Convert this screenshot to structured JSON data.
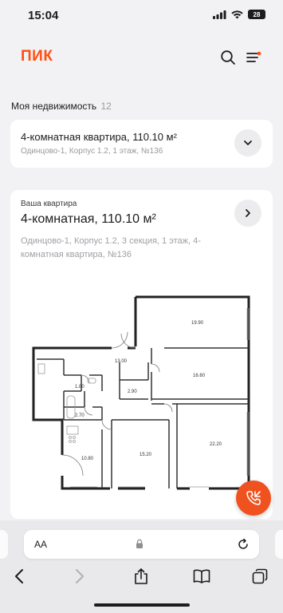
{
  "status": {
    "time": "15:04",
    "battery": "28"
  },
  "header": {
    "logo": "ПИК"
  },
  "section": {
    "title": "Моя недвижимость",
    "count": "12"
  },
  "collapsed_card": {
    "title": "4-комнатная квартира, 110.10 м²",
    "subtitle": "Одинцово-1, Корпус 1.2, 1 этаж, №136"
  },
  "main_card": {
    "label": "Ваша квартира",
    "title": "4-комнатная, 110.10 м²",
    "description": "Одинцово-1, Корпус 1.2, 3 секция, 1 этаж, 4-комнатная квартира, №136"
  },
  "floor_plan": {
    "rooms": [
      "19.90",
      "13.00",
      "16.60",
      "1.80",
      "2.90",
      "2.70",
      "10.80",
      "15.20",
      "22.20"
    ]
  },
  "browser": {
    "aa_label": "AA"
  },
  "colors": {
    "brand": "#ff4f12",
    "fab": "#f0521f"
  }
}
